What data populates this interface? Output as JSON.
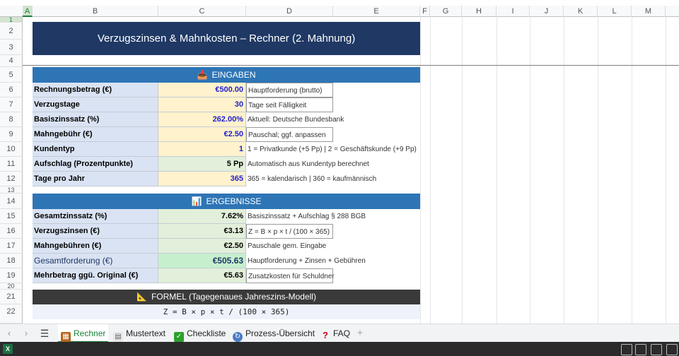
{
  "columns": [
    "A",
    "B",
    "C",
    "D",
    "E",
    "F",
    "G",
    "H",
    "I",
    "J",
    "K",
    "L",
    "M"
  ],
  "rows": [
    "1",
    "2",
    "3",
    "4",
    "5",
    "6",
    "7",
    "8",
    "9",
    "10",
    "11",
    "12",
    "13",
    "14",
    "15",
    "16",
    "17",
    "18",
    "19",
    "20",
    "21",
    "22"
  ],
  "title": "Verzugszinsen & Mahnkosten – Rechner (2. Mahnung)",
  "inputs": {
    "header": "EINGABEN",
    "header_icon": "inbox-tray-icon",
    "rows": [
      {
        "label": "Rechnungsbetrag (€)",
        "value": "€500.00",
        "note": "Hauptforderung (brutto)"
      },
      {
        "label": "Verzugstage",
        "value": "30",
        "note": "Tage seit Fälligkeit"
      },
      {
        "label": "Basiszinssatz (%)",
        "value": "262.00%",
        "note": "Aktuell: Deutsche Bundesbank"
      },
      {
        "label": "Mahngebühr (€)",
        "value": "€2.50",
        "note": "Pauschal; ggf. anpassen"
      },
      {
        "label": "Kundentyp",
        "value": "1",
        "note": "1 = Privatkunde (+5 Pp) | 2 = Geschäftskunde (+9 Pp)"
      },
      {
        "label": "Aufschlag (Prozentpunkte)",
        "value": "5 Pp",
        "note": "Automatisch aus Kundentyp berechnet"
      },
      {
        "label": "Tage pro Jahr",
        "value": "365",
        "note": "365 = kalendarisch | 360 = kaufmännisch"
      }
    ]
  },
  "results": {
    "header": "ERGEBNISSE",
    "header_icon": "bar-chart-icon",
    "rows": [
      {
        "label": "Gesamtzinssatz (%)",
        "value": "7.62%",
        "note": "Basiszinssatz + Aufschlag § 288 BGB"
      },
      {
        "label": "Verzugszinsen (€)",
        "value": "€3.13",
        "note": "Z = B × p × t / (100 × 365)"
      },
      {
        "label": "Mahngebühren (€)",
        "value": "€2.50",
        "note": "Pauschale gem. Eingabe"
      },
      {
        "label": "Gesamtforderung (€)",
        "value": "€505.63",
        "note": "Hauptforderung + Zinsen + Gebühren"
      },
      {
        "label": "Mehrbetrag ggü. Original (€)",
        "value": "€5.63",
        "note": "Zusatzkosten für Schuldner"
      }
    ]
  },
  "formula": {
    "header": "FORMEL (Tagegenaues Jahreszins-Modell)",
    "header_icon": "triangle-ruler-icon",
    "text": "Z  =  B × p × t  /  (100 × 365)"
  },
  "tabs": [
    {
      "label": "Rechner",
      "icon": "calculator-icon",
      "active": true
    },
    {
      "label": "Mustertext",
      "icon": "document-icon",
      "active": false
    },
    {
      "label": "Checkliste",
      "icon": "checkmark-icon",
      "active": false
    },
    {
      "label": "Prozess-Übersicht",
      "icon": "process-icon",
      "active": false
    },
    {
      "label": "FAQ",
      "icon": "question-icon",
      "active": false
    }
  ],
  "colors": {
    "title_bg": "#1f3864",
    "section_bg": "#2e75b6",
    "input_bg": "#fff2cc",
    "input_text": "#1f1fd0",
    "result_bg": "#e2efda",
    "total_bg": "#c6efce",
    "label_bg": "#dae3f3",
    "formula_bg": "#3a3a3a",
    "accent": "#188038"
  }
}
